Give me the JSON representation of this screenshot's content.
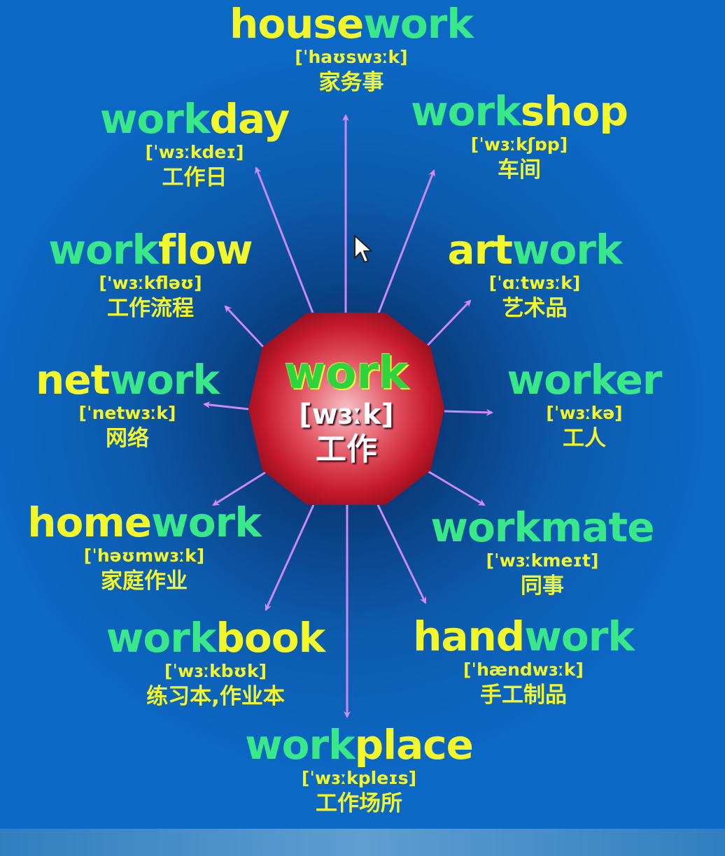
{
  "center": {
    "word": "work",
    "phonetic": "[wɜːk]",
    "meaning": "工作"
  },
  "words": [
    {
      "id": "housework",
      "parts": [
        {
          "t": "house",
          "c": "y"
        },
        {
          "t": "work",
          "c": "g"
        }
      ],
      "phonetic": "[ˈhaʊswɜːk]",
      "meaning": "家务事"
    },
    {
      "id": "workday",
      "parts": [
        {
          "t": "work",
          "c": "g"
        },
        {
          "t": "day",
          "c": "y"
        }
      ],
      "phonetic": "[ˈwɜːkdeɪ]",
      "meaning": "工作日"
    },
    {
      "id": "workshop",
      "parts": [
        {
          "t": "work",
          "c": "g"
        },
        {
          "t": "shop",
          "c": "y"
        }
      ],
      "phonetic": "[ˈwɜːkʃɒp]",
      "meaning": "车间"
    },
    {
      "id": "workflow",
      "parts": [
        {
          "t": "work",
          "c": "g"
        },
        {
          "t": "flow",
          "c": "y"
        }
      ],
      "phonetic": "['wɜːkfləʊ]",
      "meaning": "工作流程"
    },
    {
      "id": "artwork",
      "parts": [
        {
          "t": "art",
          "c": "y"
        },
        {
          "t": "work",
          "c": "g"
        }
      ],
      "phonetic": "[ˈɑːtwɜːk]",
      "meaning": "艺术品"
    },
    {
      "id": "network",
      "parts": [
        {
          "t": "net",
          "c": "y"
        },
        {
          "t": "work",
          "c": "g"
        }
      ],
      "phonetic": "[ˈnetwɜːk]",
      "meaning": "网络"
    },
    {
      "id": "worker",
      "parts": [
        {
          "t": "work",
          "c": "g"
        },
        {
          "t": "er",
          "c": "g"
        }
      ],
      "phonetic": "[ˈwɜːkə]",
      "meaning": "工人"
    },
    {
      "id": "homework",
      "parts": [
        {
          "t": "home",
          "c": "y"
        },
        {
          "t": "work",
          "c": "g"
        }
      ],
      "phonetic": "[ˈhəʊmwɜːk]",
      "meaning": "家庭作业"
    },
    {
      "id": "workmate",
      "parts": [
        {
          "t": "work",
          "c": "g"
        },
        {
          "t": "mate",
          "c": "g"
        }
      ],
      "phonetic": "[ˈwɜːkmeɪt]",
      "meaning": "同事"
    },
    {
      "id": "workbook",
      "parts": [
        {
          "t": "work",
          "c": "g"
        },
        {
          "t": "book",
          "c": "y"
        }
      ],
      "phonetic": "[ˈwɜːkbʊk]",
      "meaning": "练习本,作业本"
    },
    {
      "id": "handwork",
      "parts": [
        {
          "t": "hand",
          "c": "y"
        },
        {
          "t": "work",
          "c": "g"
        }
      ],
      "phonetic": "[ˈhændwɜːk]",
      "meaning": "手工制品"
    },
    {
      "id": "workplace",
      "parts": [
        {
          "t": "work",
          "c": "g"
        },
        {
          "t": "place",
          "c": "y"
        }
      ],
      "phonetic": "[ˈwɜːkpleɪs]",
      "meaning": "工作场所"
    }
  ],
  "colors": {
    "background": "#0b68c4",
    "root_green": "#39e889",
    "affix_yellow": "#f3f72a",
    "hub_red": "#c5192c",
    "arrow": "#c070f0"
  },
  "icons": {
    "cursor": "mouse-pointer-icon"
  }
}
